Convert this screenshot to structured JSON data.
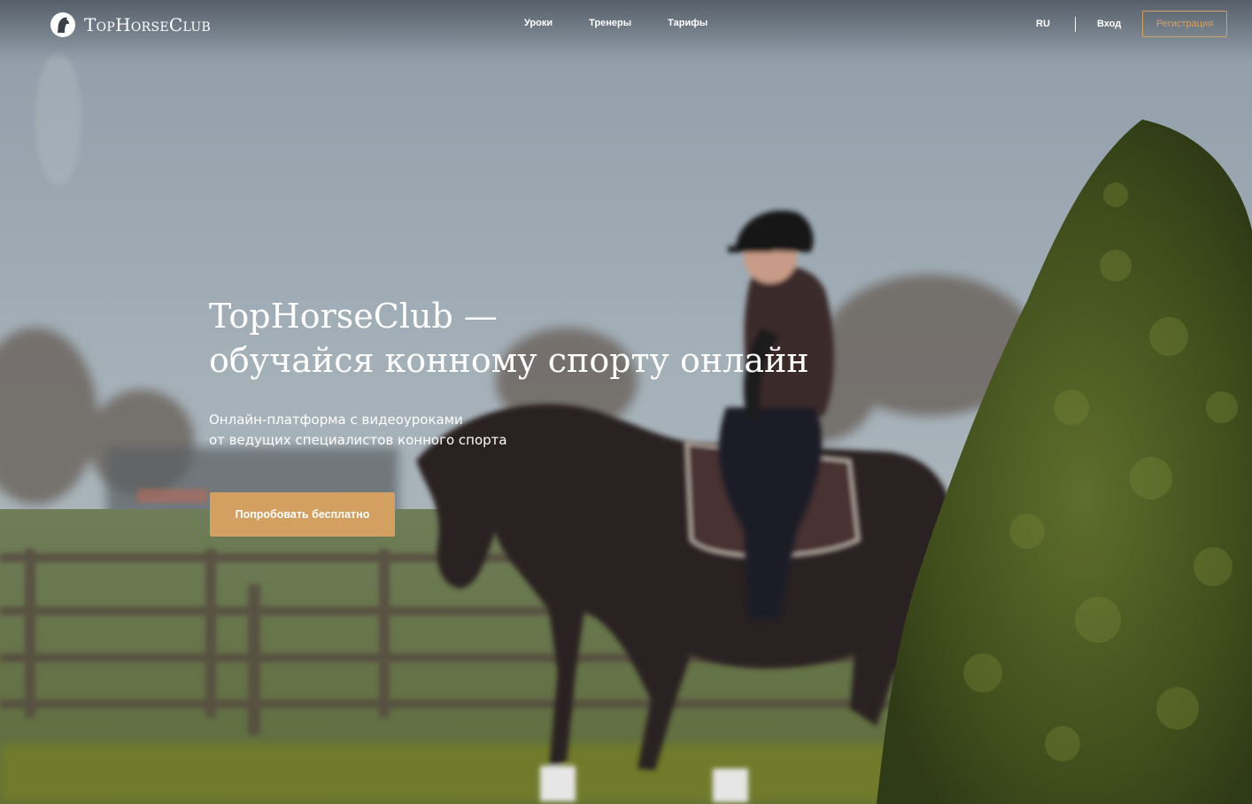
{
  "header": {
    "logo_text": "TopHorseClub",
    "nav": [
      "Уроки",
      "Тренеры",
      "Тарифы"
    ],
    "language": "RU",
    "login_label": "Вход",
    "register_label": "Регистрация"
  },
  "hero": {
    "title_line1": "TopHorseClub —",
    "title_line2": "обучайся конному спорту онлайн",
    "subtitle_line1": "Онлайн-платформа с видеоуроками",
    "subtitle_line2": "от ведущих специалистов конного спорта",
    "cta_label": "Попробовать бесплатно"
  },
  "colors": {
    "accent": "#d4a062",
    "text": "#ffffff"
  },
  "icons": {
    "logo": "horse-head-logo-icon"
  }
}
